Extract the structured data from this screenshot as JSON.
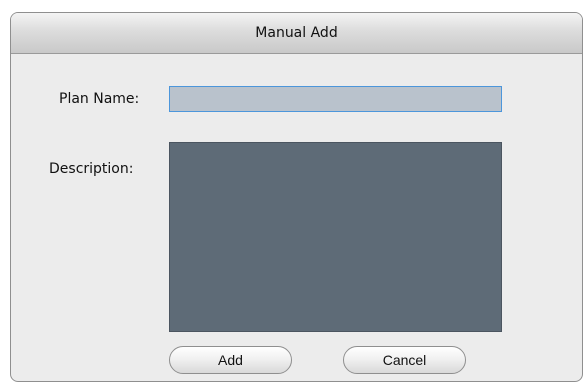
{
  "dialog": {
    "title": "Manual Add"
  },
  "form": {
    "plan_name_label": "Plan Name:",
    "plan_name_value": "",
    "description_label": "Description:",
    "description_value": ""
  },
  "buttons": {
    "add_label": "Add",
    "cancel_label": "Cancel"
  },
  "colors": {
    "dialog_background": "#ececec",
    "plan_input_background": "#b9c2cc",
    "plan_input_border": "#4c96db",
    "description_background": "#5e6b77"
  }
}
